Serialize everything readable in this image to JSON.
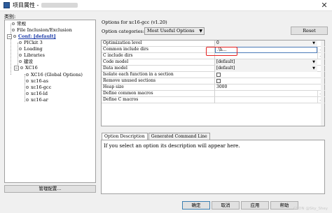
{
  "window": {
    "title": "项目属性 -",
    "close_glyph": "✕"
  },
  "categories_label": "类别:",
  "tree": {
    "items": [
      {
        "label": "常规",
        "kind": "leaf"
      },
      {
        "label": "File Inclusion/Exclusion",
        "kind": "leaf"
      },
      {
        "label": "Conf: [default]",
        "kind": "expanded"
      },
      {
        "label": "PICkit 3",
        "kind": "leaf"
      },
      {
        "label": "Loading",
        "kind": "leaf"
      },
      {
        "label": "Libraries",
        "kind": "leaf"
      },
      {
        "label": "建设",
        "kind": "leaf"
      },
      {
        "label": "XC16",
        "kind": "expanded"
      },
      {
        "label": "XC16 (Global Options)",
        "kind": "leaf"
      },
      {
        "label": "xc16-as",
        "kind": "leaf"
      },
      {
        "label": "xc16-gcc",
        "kind": "leaf"
      },
      {
        "label": "xc16-ld",
        "kind": "leaf"
      },
      {
        "label": "xc16-ar",
        "kind": "leaf"
      }
    ],
    "expander_minus": "−"
  },
  "manage_button": "管理配置...",
  "options_for": "Options for xc16-gcc (v1.20)",
  "option_categories": {
    "label": "Option categories:",
    "selected": "Most Useful Options",
    "arrow": "▼"
  },
  "reset_button": "Reset",
  "grid": {
    "dots": "...",
    "rows": [
      {
        "name": "Optimization level",
        "value": "0",
        "type": "dropdown"
      },
      {
        "name": "Common include dirs",
        "value": ".\\h...",
        "type": "text-selected"
      },
      {
        "name": "C include dirs",
        "value": "",
        "type": "text"
      },
      {
        "name": "Code model",
        "value": "[default]",
        "type": "dropdown"
      },
      {
        "name": "Data model",
        "value": "[default]",
        "type": "dropdown"
      },
      {
        "name": "Isolate each function in a section",
        "value": "",
        "type": "checkbox"
      },
      {
        "name": "Remove unused sections",
        "value": "",
        "type": "checkbox"
      },
      {
        "name": "Heap size",
        "value": "3000",
        "type": "text"
      },
      {
        "name": "Define common macros",
        "value": "",
        "type": "text"
      },
      {
        "name": "Define C macros",
        "value": "",
        "type": "text"
      }
    ]
  },
  "description": {
    "tabs": [
      "Option Description",
      "Generated Command Line"
    ],
    "text": "If you select an option its description will appear here."
  },
  "buttons": {
    "ok": "确定",
    "cancel": "取消",
    "apply": "应用",
    "help": "帮助"
  },
  "watermark": "CSDN @Sky_Shey",
  "colors": {
    "highlight": "#e52020",
    "selected_tree": "#1a3aa8"
  }
}
